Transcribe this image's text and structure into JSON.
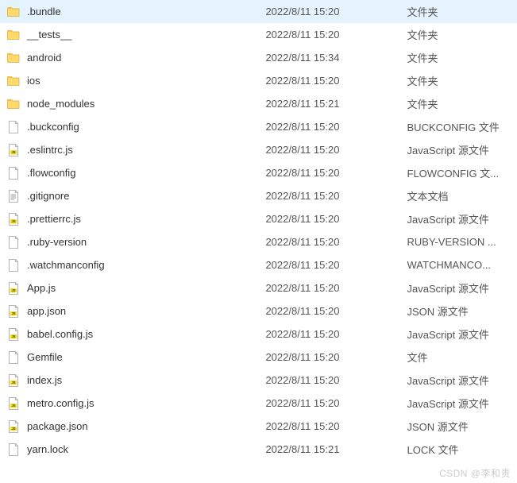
{
  "files": [
    {
      "icon": "folder",
      "name": ".bundle",
      "date": "2022/8/11 15:20",
      "type": "文件夹"
    },
    {
      "icon": "folder",
      "name": "__tests__",
      "date": "2022/8/11 15:20",
      "type": "文件夹"
    },
    {
      "icon": "folder",
      "name": "android",
      "date": "2022/8/11 15:34",
      "type": "文件夹"
    },
    {
      "icon": "folder",
      "name": "ios",
      "date": "2022/8/11 15:20",
      "type": "文件夹"
    },
    {
      "icon": "folder",
      "name": "node_modules",
      "date": "2022/8/11 15:21",
      "type": "文件夹"
    },
    {
      "icon": "file",
      "name": ".buckconfig",
      "date": "2022/8/11 15:20",
      "type": "BUCKCONFIG 文件"
    },
    {
      "icon": "js",
      "name": ".eslintrc.js",
      "date": "2022/8/11 15:20",
      "type": "JavaScript 源文件"
    },
    {
      "icon": "file",
      "name": ".flowconfig",
      "date": "2022/8/11 15:20",
      "type": "FLOWCONFIG 文..."
    },
    {
      "icon": "text",
      "name": ".gitignore",
      "date": "2022/8/11 15:20",
      "type": "文本文档"
    },
    {
      "icon": "js",
      "name": ".prettierrc.js",
      "date": "2022/8/11 15:20",
      "type": "JavaScript 源文件"
    },
    {
      "icon": "file",
      "name": ".ruby-version",
      "date": "2022/8/11 15:20",
      "type": "RUBY-VERSION ..."
    },
    {
      "icon": "file",
      "name": ".watchmanconfig",
      "date": "2022/8/11 15:20",
      "type": "WATCHMANCO..."
    },
    {
      "icon": "js",
      "name": "App.js",
      "date": "2022/8/11 15:20",
      "type": "JavaScript 源文件"
    },
    {
      "icon": "json",
      "name": "app.json",
      "date": "2022/8/11 15:20",
      "type": "JSON 源文件"
    },
    {
      "icon": "js",
      "name": "babel.config.js",
      "date": "2022/8/11 15:20",
      "type": "JavaScript 源文件"
    },
    {
      "icon": "file",
      "name": "Gemfile",
      "date": "2022/8/11 15:20",
      "type": "文件"
    },
    {
      "icon": "js",
      "name": "index.js",
      "date": "2022/8/11 15:20",
      "type": "JavaScript 源文件"
    },
    {
      "icon": "js",
      "name": "metro.config.js",
      "date": "2022/8/11 15:20",
      "type": "JavaScript 源文件"
    },
    {
      "icon": "json",
      "name": "package.json",
      "date": "2022/8/11 15:20",
      "type": "JSON 源文件"
    },
    {
      "icon": "file",
      "name": "yarn.lock",
      "date": "2022/8/11 15:21",
      "type": "LOCK 文件"
    }
  ],
  "watermark": "CSDN @李和贵",
  "icon_svgs": {
    "folder": "<svg width='18' height='18' viewBox='0 0 18 18'><path d='M1.5 3.5 h5 l1.5 1.5 h8 v9.5 h-14.5 z' fill='#ffd96a' stroke='#d9a93c' stroke-width='0.7'/><path d='M1.5 3.5 h5 l1.5 1.5 h-6.5 z' fill='#f0c24b'/></svg>",
    "file": "<svg width='18' height='18' viewBox='0 0 18 18'><path d='M3.5 1.5 h8 l3 3 v12 h-11 z' fill='#ffffff' stroke='#a0a0a0' stroke-width='0.8'/><path d='M11.5 1.5 v3 h3' fill='none' stroke='#a0a0a0' stroke-width='0.8'/></svg>",
    "text": "<svg width='18' height='18' viewBox='0 0 18 18'><path d='M3.5 1.5 h8 l3 3 v12 h-11 z' fill='#ffffff' stroke='#a0a0a0' stroke-width='0.8'/><path d='M11.5 1.5 v3 h3' fill='none' stroke='#a0a0a0' stroke-width='0.8'/><line x1='5.5' y1='7' x2='12' y2='7' stroke='#888' stroke-width='0.8'/><line x1='5.5' y1='9' x2='12' y2='9' stroke='#888' stroke-width='0.8'/><line x1='5.5' y1='11' x2='12' y2='11' stroke='#888' stroke-width='0.8'/><line x1='5.5' y1='13' x2='10' y2='13' stroke='#888' stroke-width='0.8'/></svg>",
    "js": "<svg width='18' height='18' viewBox='0 0 18 18'><path d='M3.5 1.5 h8 l3 3 v12 h-11 z' fill='#ffffff' stroke='#a0a0a0' stroke-width='0.8'/><path d='M11.5 1.5 v3 h3' fill='none' stroke='#a0a0a0' stroke-width='0.8'/><rect x='4.8' y='9' width='8.4' height='5.5' rx='1' fill='#f7df1e'/><text x='9' y='13.2' font-size='4.2' font-family='Arial' font-weight='bold' fill='#333' text-anchor='middle'>JS</text></svg>",
    "json": "<svg width='18' height='18' viewBox='0 0 18 18'><path d='M3.5 1.5 h8 l3 3 v12 h-11 z' fill='#ffffff' stroke='#a0a0a0' stroke-width='0.8'/><path d='M11.5 1.5 v3 h3' fill='none' stroke='#a0a0a0' stroke-width='0.8'/><rect x='4.8' y='9' width='8.4' height='5.5' rx='1' fill='#f7df1e'/><text x='9' y='13.2' font-size='4.2' font-family='Arial' font-weight='bold' fill='#333' text-anchor='middle'>JS</text></svg>"
  }
}
